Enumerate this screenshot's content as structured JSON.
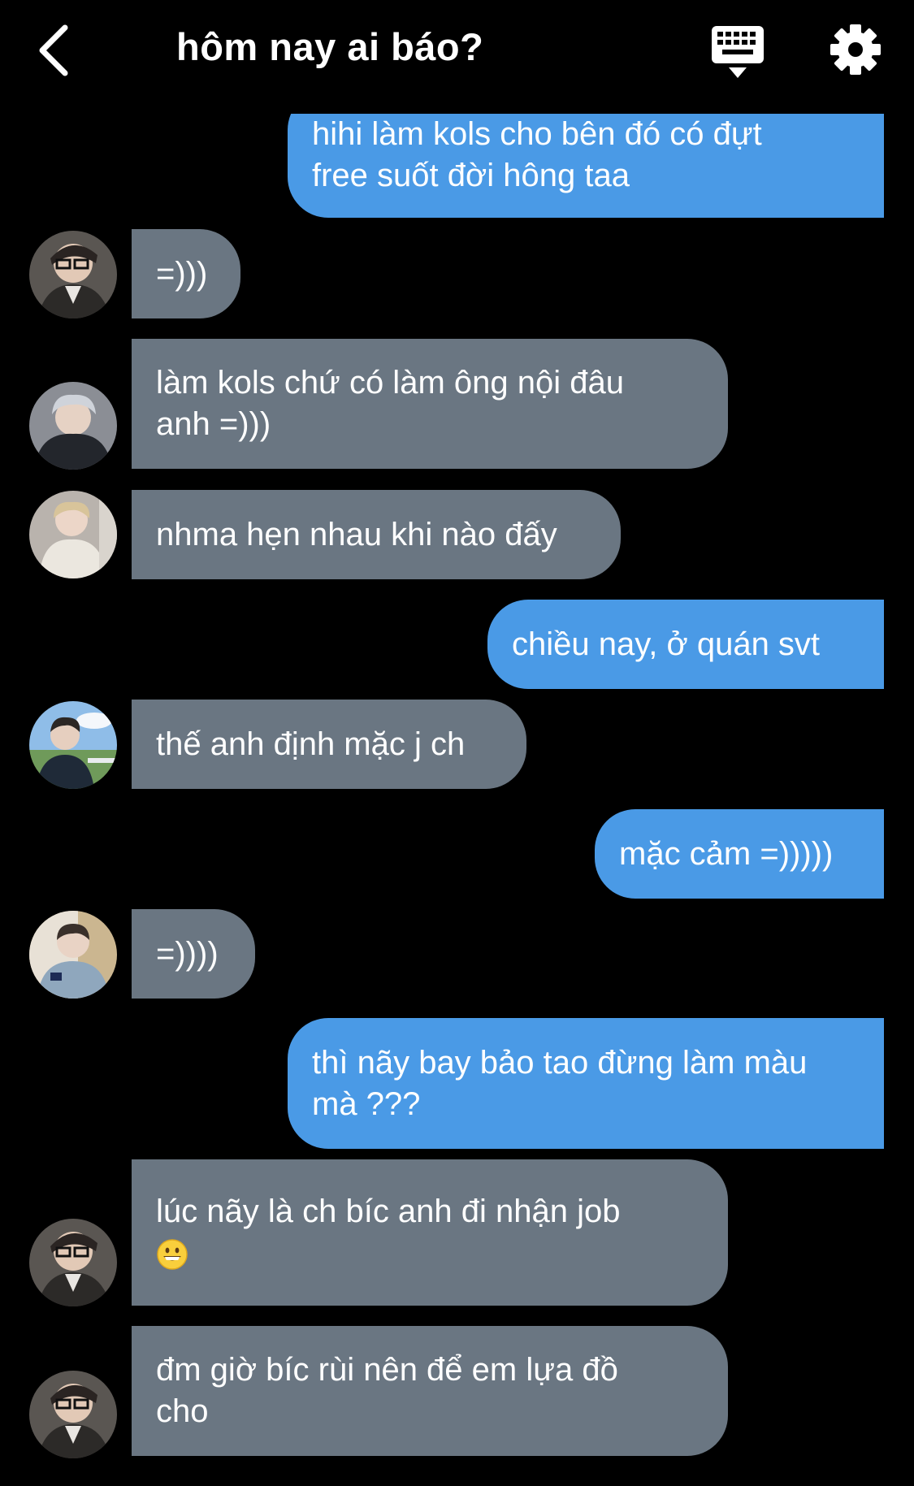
{
  "header": {
    "title": "hôm nay ai báo?",
    "back_icon": "chevron-left-icon",
    "keyboard_icon": "keyboard-icon",
    "settings_icon": "gear-icon"
  },
  "colors": {
    "background": "#000000",
    "sent_bubble": "#4a9ae6",
    "received_bubble": "#6a7682",
    "text": "#ffffff"
  },
  "messages": [
    {
      "side": "sent",
      "lines": [
        "hihi làm kols cho bên đó có đựt",
        "free suốt đời hông taa"
      ]
    },
    {
      "side": "received",
      "lines": [
        "=)))"
      ]
    },
    {
      "side": "received",
      "lines": [
        "làm kols chứ có làm ông nội đâu",
        "anh =)))"
      ]
    },
    {
      "side": "received",
      "lines": [
        "nhma hẹn nhau khi nào đấy"
      ]
    },
    {
      "side": "sent",
      "lines": [
        "chiều nay, ở quán svt"
      ]
    },
    {
      "side": "received",
      "lines": [
        "thế anh định mặc j ch"
      ]
    },
    {
      "side": "sent",
      "lines": [
        "mặc cảm =)))))"
      ]
    },
    {
      "side": "received",
      "lines": [
        "=))))"
      ]
    },
    {
      "side": "sent",
      "lines": [
        "thì nãy bay bảo tao đừng làm màu",
        "mà ???"
      ]
    },
    {
      "side": "received",
      "lines": [
        "lúc nãy là ch bíc anh đi nhận job"
      ],
      "emoji": "grinning-face-emoji"
    },
    {
      "side": "received",
      "lines": [
        "đm giờ bíc rùi nên để em lựa đồ",
        "cho"
      ]
    }
  ]
}
